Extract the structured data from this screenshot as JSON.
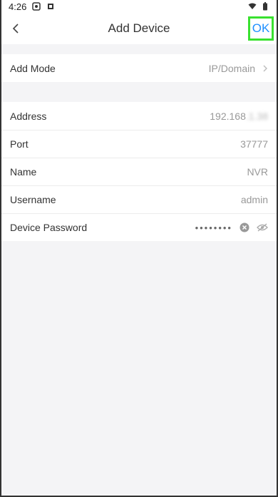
{
  "status_bar": {
    "time": "4:26"
  },
  "header": {
    "title": "Add Device",
    "ok_label": "OK",
    "back_icon": "chevron-left-icon"
  },
  "add_mode": {
    "label": "Add Mode",
    "value": "IP/Domain"
  },
  "fields": {
    "address": {
      "label": "Address",
      "value_visible": "192.168",
      "value_blurred": ".1.38"
    },
    "port": {
      "label": "Port",
      "value": "37777"
    },
    "name": {
      "label": "Name",
      "value": "NVR"
    },
    "username": {
      "label": "Username",
      "value": "admin"
    },
    "password": {
      "label": "Device Password",
      "value": "••••••••"
    }
  },
  "colors": {
    "accent": "#1e90ff",
    "highlight_border": "#39e12f"
  }
}
